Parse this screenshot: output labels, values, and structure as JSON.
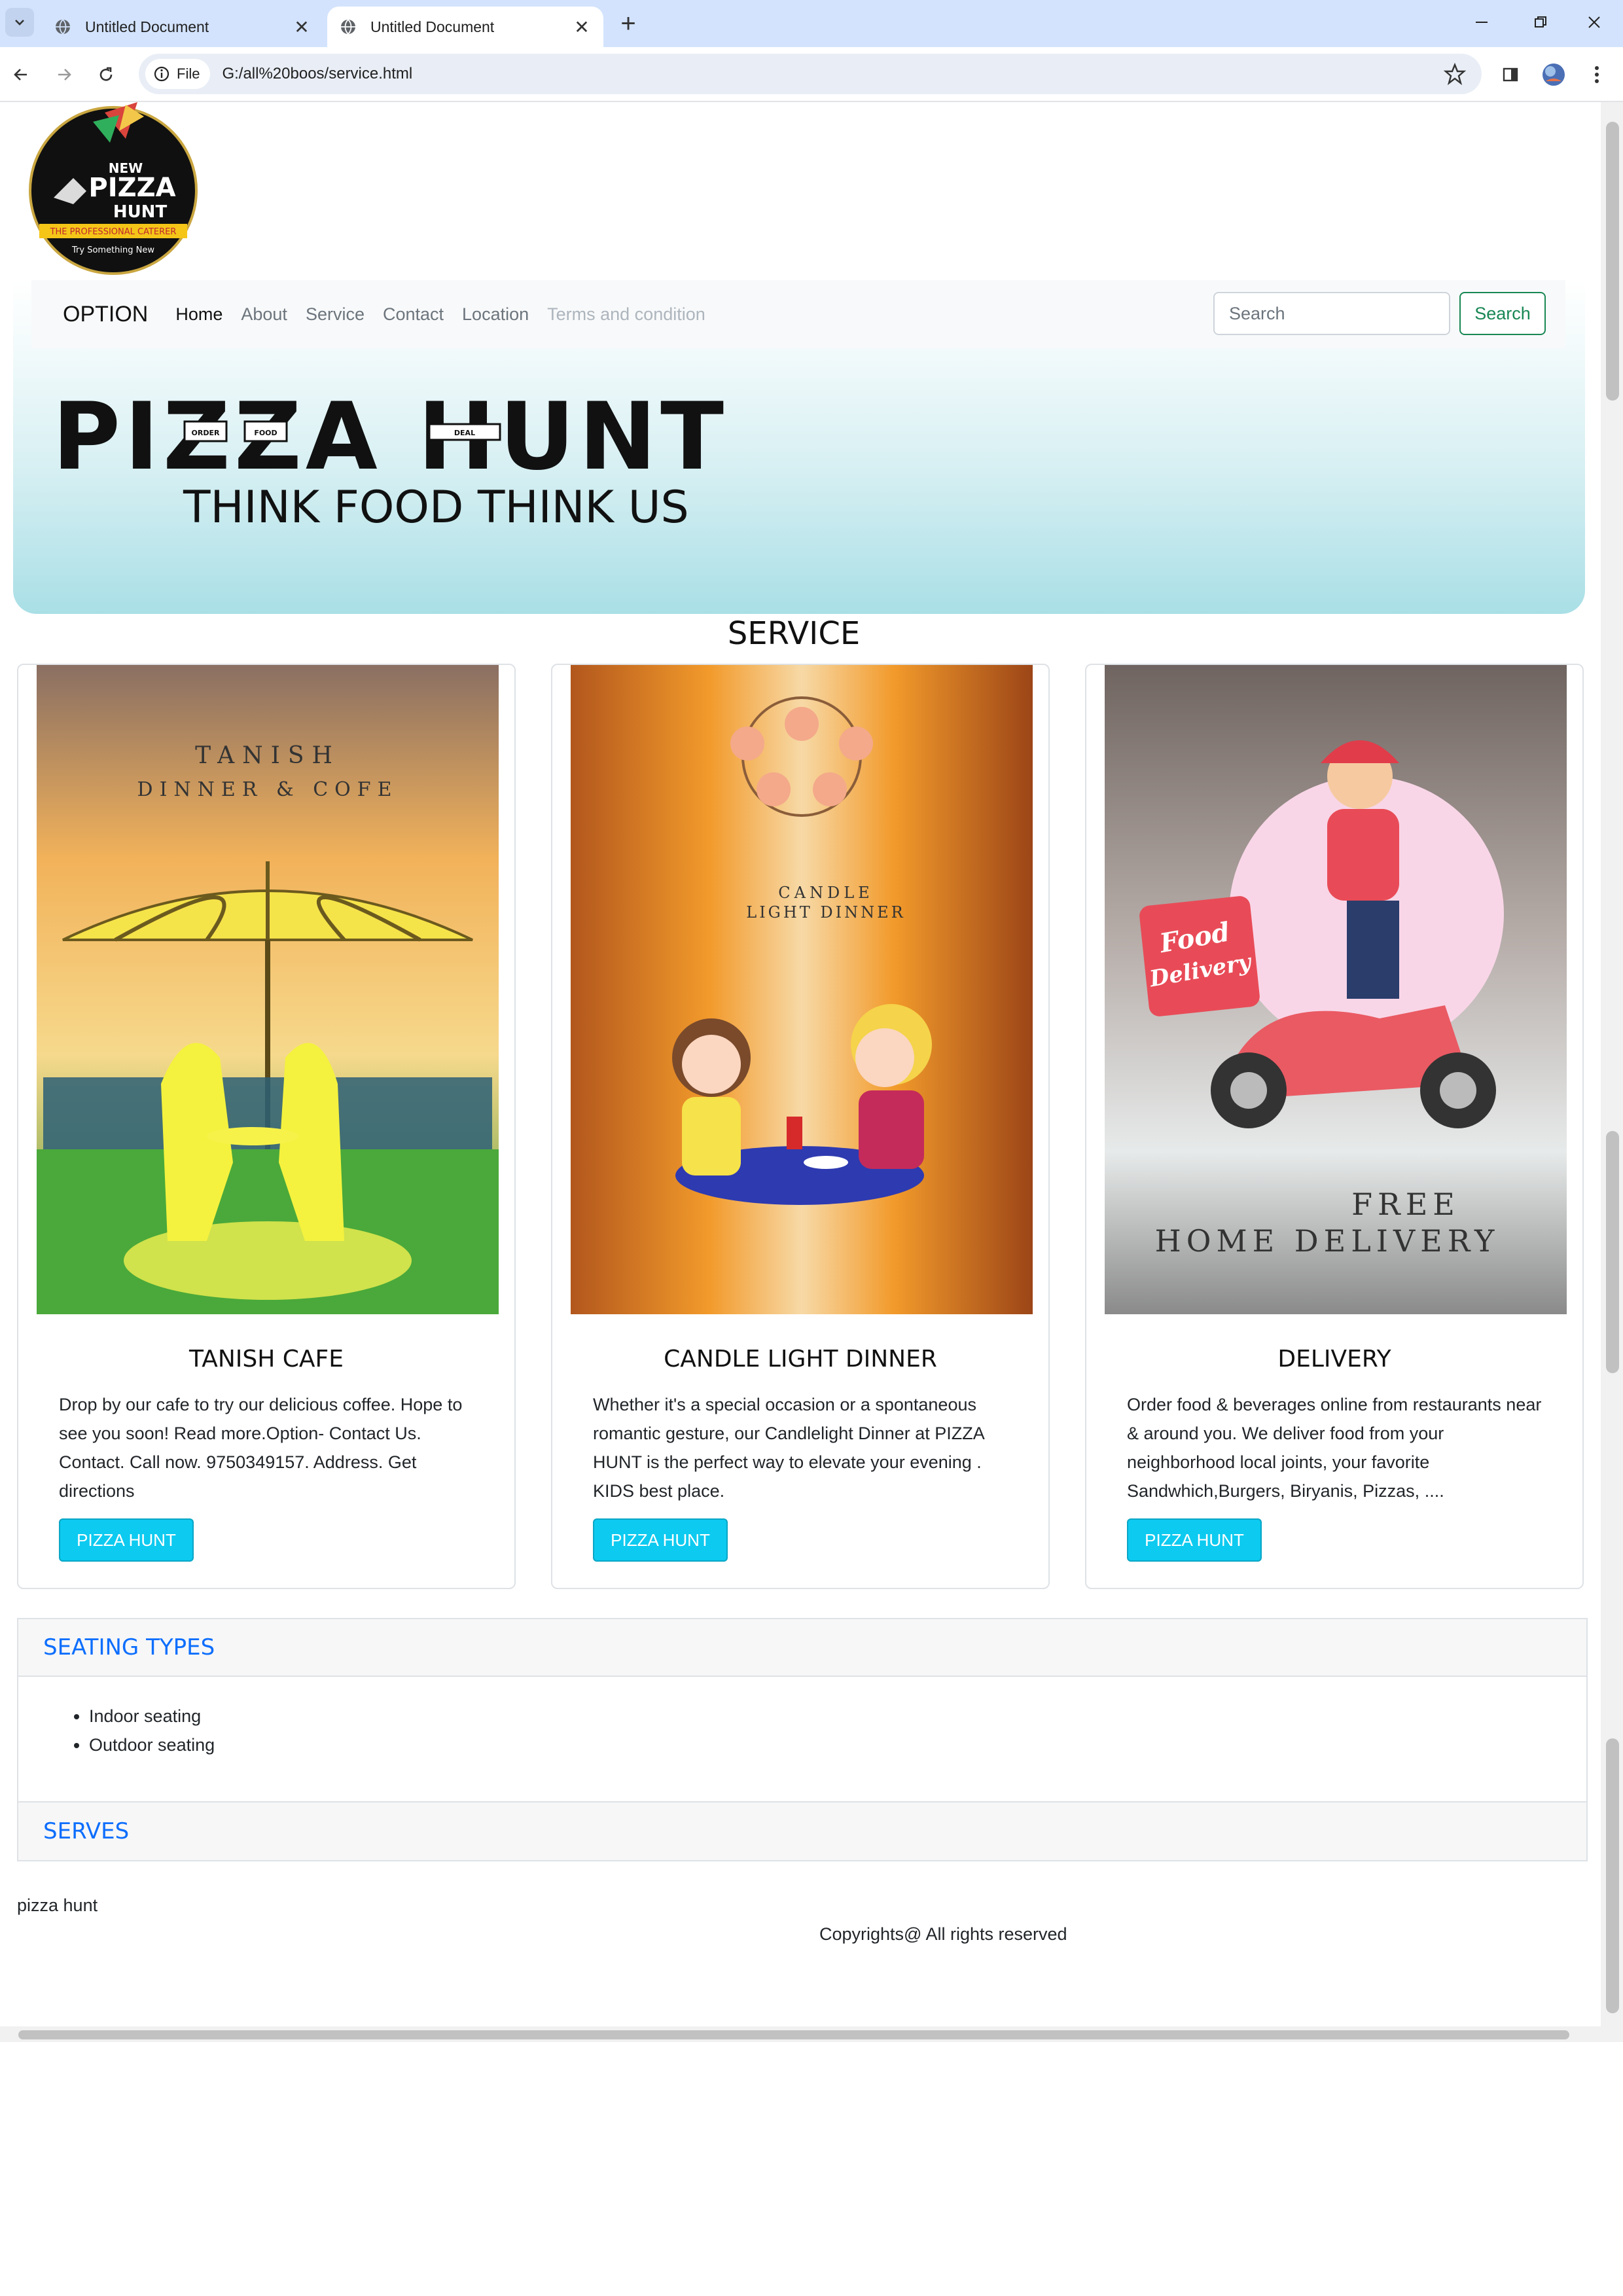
{
  "browser": {
    "tabs": [
      {
        "title": "Untitled Document",
        "active": false
      },
      {
        "title": "Untitled Document",
        "active": true
      }
    ],
    "chip_label": "File",
    "url": "G:/all%20boos/service.html",
    "icons": [
      "tab-search-icon",
      "globe-icon",
      "close-icon",
      "plus-icon",
      "minimize-icon",
      "restore-icon",
      "close-window-icon",
      "back-icon",
      "forward-icon",
      "reload-icon",
      "info-icon",
      "star-icon",
      "side-panel-icon",
      "profile-icon",
      "menu-icon"
    ]
  },
  "navbar": {
    "brand": "OPTION",
    "links": [
      "Home",
      "About",
      "Service",
      "Contact",
      "Location",
      "Terms and condition"
    ],
    "search_placeholder": "Search",
    "search_button": "Search"
  },
  "logo": {
    "text": [
      "NEW",
      "PIZZA",
      "HUNT",
      "THE PROFESSIONAL CATERER",
      "Try Something New"
    ]
  },
  "hero": {
    "headline": "PIZZA HUNT",
    "tagline": "THINK FOOD THINK US",
    "sign_labels": [
      "ORDER",
      "FOOD",
      "DEAL"
    ]
  },
  "section_title": "SERVICE",
  "cards": [
    {
      "image_text": [
        "TANISH",
        "DINNER & COFE"
      ],
      "title": "TANISH CAFE",
      "text": "Drop by our cafe to try our delicious coffee. Hope to see you soon! Read more.Option- Contact Us. Contact. Call now. 9750349157. Address. Get directions",
      "button": "PIZZA HUNT"
    },
    {
      "image_text": [
        "CANDLE",
        "LIGHT DINNER"
      ],
      "title": "CANDLE LIGHT DINNER",
      "text": "Whether it's a special occasion or a spontaneous romantic gesture, our Candlelight Dinner at PIZZA HUNT is the perfect way to elevate your evening . KIDS best place.",
      "button": "PIZZA HUNT"
    },
    {
      "image_text": [
        "Food",
        "Delivery",
        "FREE",
        "HOME DELIVERY"
      ],
      "title": "DELIVERY",
      "text": "Order food & beverages online from restaurants near & around you. We deliver food from your neighborhood local joints, your favorite Sandwhich,Burgers, Biryanis, Pizzas, ....",
      "button": "PIZZA HUNT"
    }
  ],
  "accordion": [
    {
      "title": "SEATING TYPES",
      "items": [
        "Indoor seating",
        "Outdoor seating"
      ]
    },
    {
      "title": "SERVES",
      "items": []
    }
  ],
  "footer": {
    "brand": "pizza hunt",
    "copyright": "Copyrights@ All rights reserved"
  },
  "colors": {
    "accent_blue": "#0d6efd",
    "search_green": "#198754",
    "button_cyan": "#0dcaf0",
    "chrome_frame": "#d3e3fd"
  }
}
